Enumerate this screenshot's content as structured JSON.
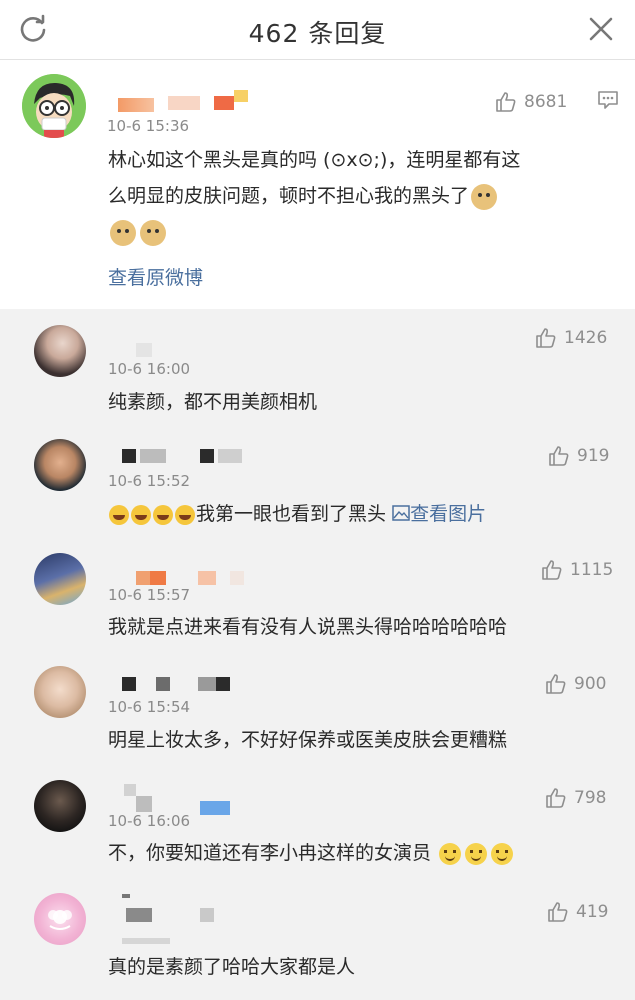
{
  "header": {
    "title": "462 条回复"
  },
  "main_comment": {
    "time": "10-6 15:36",
    "likes": "8681",
    "text_line1": "林心如这个黑头是真的吗 (⊙x⊙;)，连明星都有这",
    "text_line2": "么明显的皮肤问题，顿时不担心我的黑头了",
    "view_original": "查看原微博"
  },
  "replies": [
    {
      "time": "10-6 16:00",
      "likes": "1426",
      "text": "纯素颜，都不用美颜相机"
    },
    {
      "time": "10-6 15:52",
      "likes": "919",
      "text": "我第一眼也看到了黑头",
      "view_image": "查看图片"
    },
    {
      "time": "10-6 15:57",
      "likes": "1115",
      "text": "我就是点进来看有没有人说黑头得哈哈哈哈哈哈"
    },
    {
      "time": "10-6 15:54",
      "likes": "900",
      "text": "明星上妆太多，不好好保养或医美皮肤会更糟糕"
    },
    {
      "time": "10-6 16:06",
      "likes": "798",
      "text": "不，你要知道还有李小冉这样的女演员"
    },
    {
      "time": "",
      "likes": "419",
      "text": "真的是素颜了哈哈大家都是人"
    }
  ]
}
